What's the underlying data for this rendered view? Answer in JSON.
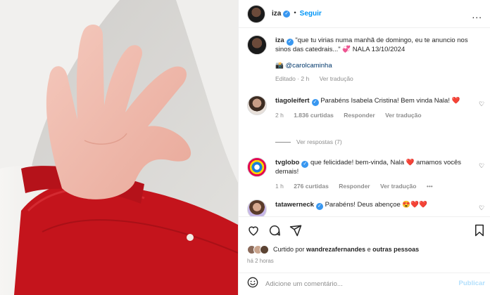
{
  "header": {
    "username": "iza",
    "separator": "•",
    "follow_label": "Seguir",
    "more_label": "..."
  },
  "caption": {
    "username": "iza",
    "text": "\"que tu virias numa manhã de domingo, eu te anuncio nos sinos das catedrais...\"",
    "emoji": "💞",
    "suffix": "NALA 13/10/2024",
    "tag_emoji": "📸",
    "tag": "@carolcaminha",
    "edited": "Editado · 2 h",
    "translation": "Ver tradução"
  },
  "comments": [
    {
      "username": "tiagoleifert",
      "text_a": "Parabéns Isabela Cristina! Bem vinda Nala!",
      "heart": "❤️",
      "time": "2 h",
      "likes": "1.836 curtidas",
      "reply": "Responder",
      "translation": "Ver tradução",
      "replies": "Ver respostas (7)"
    },
    {
      "username": "tvglobo",
      "text_a": "que felicidade! bem-vinda, Nala",
      "heart": "❤️",
      "text_b": "amamos vocês demais!",
      "time": "1 h",
      "likes": "276 curtidas",
      "reply": "Responder",
      "translation": "Ver tradução",
      "more": "•••"
    },
    {
      "username": "tatawerneck",
      "text_a": "Parabéns! Deus abençoe",
      "emojis": "😍❤️❤️"
    }
  ],
  "likes": {
    "prefix": "Curtido por",
    "user": "wandrezafernandes",
    "conj": "e",
    "others": "outras pessoas",
    "time": "há 2 horas"
  },
  "add_comment": {
    "placeholder": "Adicione um comentário...",
    "publish": "Publicar"
  },
  "icons": [
    "heart-icon",
    "comment-icon",
    "share-icon",
    "bookmark-icon",
    "emoji-icon",
    "verified-icon",
    "heart-small-icon"
  ],
  "colors": {
    "accent": "#0095f6",
    "verified": "#3897f0",
    "muted": "#8e8e8e",
    "sweater_red": "#c4141c"
  }
}
